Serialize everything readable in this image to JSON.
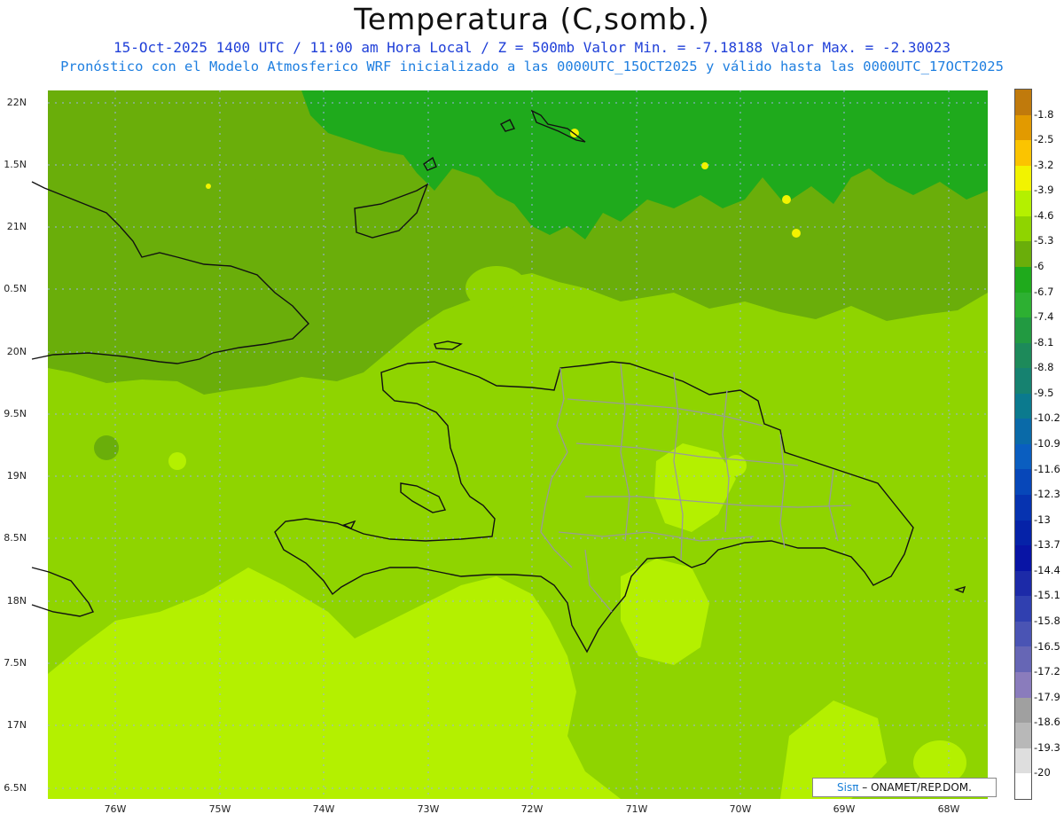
{
  "title": "Temperatura (C,somb.)",
  "subtitle1": "15-Oct-2025  1400 UTC / 11:00 am Hora Local / Z = 500mb  Valor Min. = -7.18188  Valor Max. = -2.30023",
  "subtitle2": "Pronóstico con el Modelo Atmosferico WRF inicializado a las 0000UTC_15OCT2025 y válido hasta las  0000UTC_17OCT2025",
  "lat_labels": [
    "22N",
    "1.5N",
    "21N",
    "0.5N",
    "20N",
    "9.5N",
    "19N",
    "8.5N",
    "18N",
    "7.5N",
    "17N",
    "6.5N"
  ],
  "lon_labels": [
    "76W",
    "75W",
    "74W",
    "73W",
    "72W",
    "71W",
    "70W",
    "69W",
    "68W"
  ],
  "credit": {
    "brand": "Sisπ",
    "text": "– ONAMET/REP.DOM."
  },
  "colorbar": {
    "labels": [
      "-1.8",
      "-2.5",
      "-3.2",
      "-3.9",
      "-4.6",
      "-5.3",
      "-6",
      "-6.7",
      "-7.4",
      "-8.1",
      "-8.8",
      "-9.5",
      "-10.2",
      "-10.9",
      "-11.6",
      "-12.3",
      "-13",
      "-13.7",
      "-14.4",
      "-15.1",
      "-15.8",
      "-16.5",
      "-17.2",
      "-17.9",
      "-18.6",
      "-19.3",
      "-20"
    ],
    "colors": [
      "#c07a0c",
      "#e29a00",
      "#fbc400",
      "#f2f300",
      "#b4f000",
      "#8fd400",
      "#6aae0a",
      "#1faa1c",
      "#2db032",
      "#229a41",
      "#1d8a5a",
      "#168270",
      "#0b7a8e",
      "#0a6aa8",
      "#0a5ec0",
      "#0747b9",
      "#0633b0",
      "#0522a8",
      "#0814a5",
      "#1c2aa8",
      "#3040b0",
      "#4a54b4",
      "#6666b5",
      "#8a7cbc",
      "#a0a0a0",
      "#b8b8b8",
      "#dedede",
      "#ffffff"
    ]
  },
  "colors": {
    "land_outline": "#111111",
    "province_border": "#9a9a9a",
    "grid": "#9ab0e8",
    "field_dark_band": "#1faa1c",
    "field_mid_band": "#6aae0a",
    "field_main": "#8fd400",
    "field_light": "#b4f000"
  }
}
